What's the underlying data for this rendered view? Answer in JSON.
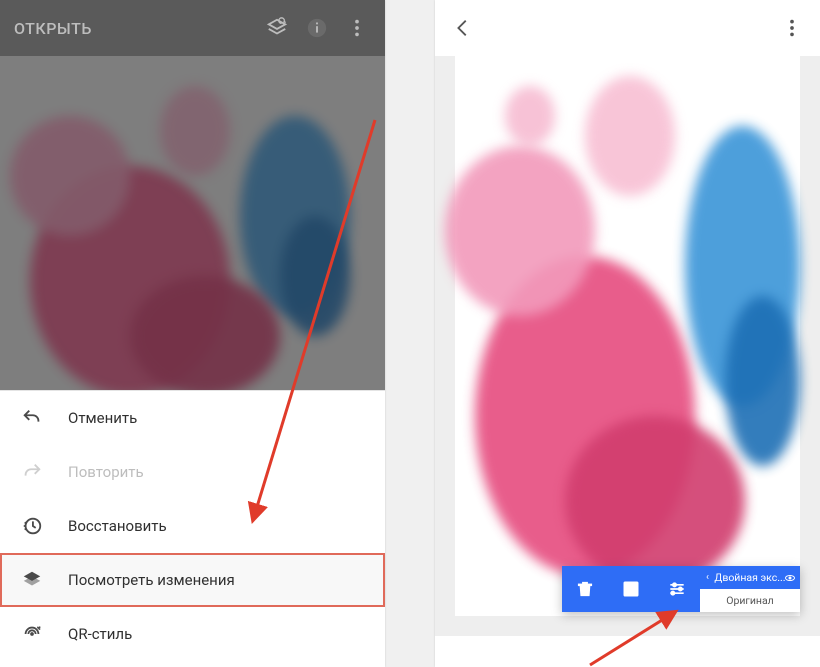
{
  "left": {
    "topbar": {
      "title": "ОТКРЫТЬ",
      "icons": {
        "layers": "layers-refresh",
        "info": "info",
        "more": "more-vert"
      }
    },
    "menu": {
      "undo": "Отменить",
      "redo": "Повторить",
      "restore": "Восстановить",
      "view_changes": "Посмотреть изменения",
      "qr_style": "QR-стиль"
    }
  },
  "right": {
    "topbar": {
      "back": "back",
      "more": "more-vert"
    },
    "toolstrip": {
      "delete": "delete",
      "edit": "edit",
      "tune": "tune",
      "stack_top": "Двойная экс...",
      "stack_bottom": "Оригинал"
    }
  },
  "colors": {
    "accent": "#2e6df6",
    "highlight_outline": "#e06a5a",
    "pink": "#e64c7f",
    "pink_light": "#f29abb",
    "blue_ink": "#3a95d8",
    "blue_deep": "#1d6fb5"
  }
}
